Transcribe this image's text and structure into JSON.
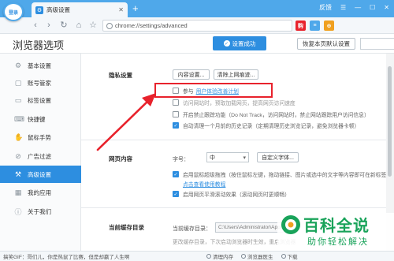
{
  "browser": {
    "login_badge": "登录",
    "tab_title": "高级设置",
    "tab_close": "✕",
    "new_tab": "+",
    "title_right": [
      "反馈",
      "☰",
      "—",
      "☐",
      "✕"
    ],
    "nav": [
      "‹",
      "›",
      "↻",
      "⌂",
      "☆"
    ],
    "address": "chrome://settings/advanced",
    "ext_icons": [
      {
        "label": "购",
        "color": "#e8222c"
      },
      {
        "label": "≡",
        "color": "#4fa8ea"
      },
      {
        "label": "⊕",
        "color": "#f0a020"
      }
    ]
  },
  "header": {
    "title": "浏览器选项",
    "save_banner": "设置成功",
    "restore_button": "恢复本页默认设置"
  },
  "sidebar": {
    "items": [
      {
        "label": "基本设置",
        "icon": "⚙",
        "active": false
      },
      {
        "label": "账号管家",
        "icon": "▢",
        "active": false
      },
      {
        "label": "标签设置",
        "icon": "▭",
        "active": false
      },
      {
        "label": "快捷键",
        "icon": "⌨",
        "active": false
      },
      {
        "label": "鼠标手势",
        "icon": "✋",
        "active": false
      },
      {
        "label": "广告过滤",
        "icon": "⊘",
        "active": false
      },
      {
        "label": "高级设置",
        "icon": "⚒",
        "active": true
      },
      {
        "label": "我的应用",
        "icon": "▦",
        "active": false
      },
      {
        "label": "关于我们",
        "icon": "ⓘ",
        "active": false
      }
    ]
  },
  "privacy": {
    "label": "隐私设置",
    "content_settings": "内容设置...",
    "clear_data": "清除上网痕迹...",
    "options": [
      {
        "prefix": "参与",
        "link": "用户体验改善计划",
        "text": "",
        "checked": false
      },
      {
        "prefix": "",
        "link": "",
        "text": "访问网站时，预取加载网页，提高网页访问速度",
        "checked": false
      },
      {
        "prefix": "",
        "link": "",
        "text": "开启禁止跟踪功能（Do Not Track，访问网站时，禁止网站跟踪用户访问信息）",
        "checked": false
      },
      {
        "prefix": "",
        "link": "",
        "text": "自动清理一个月前的历史记录（定期清理历史浏览记录，避免浏览器卡顿）",
        "checked": true
      }
    ]
  },
  "web_content": {
    "label": "网页内容",
    "font_label": "字号：",
    "font_value": "中",
    "custom_font_button": "自定义字体...",
    "options": [
      {
        "text": "启用鼠标超级拖拽（按住鼠标左键，拖动链接、图片或选中的文字等内容即可在新标签中打开）",
        "link": "点击查看使用教程",
        "checked": true
      },
      {
        "text": "启用网页平滑滚动效果（滚动网页时更顺畅）",
        "link": "",
        "checked": true
      }
    ]
  },
  "cache": {
    "label": "当前缓存目录",
    "dir_label": "当前缓存目录：",
    "dir_value": "C:\\Users\\Administrator\\AppData",
    "change_hint": "更改缓存目录，下次启动浏览器时生效，重启浏览器"
  },
  "watermark": {
    "title": "百科全说",
    "subtitle": "助你轻松解决"
  },
  "statusbar": {
    "news": "搞笑GIF：哥们儿，你是热鼠了比赛，但是却赢了人生啊",
    "tools": [
      "清理内存",
      "浏览器医生",
      "下载"
    ]
  }
}
